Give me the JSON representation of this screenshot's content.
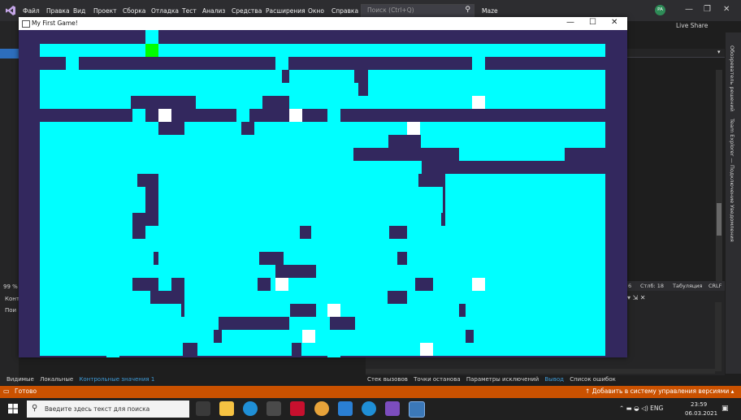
{
  "vs": {
    "menu": [
      "Файл",
      "Правка",
      "Вид",
      "Проект",
      "Сборка",
      "Отладка",
      "Тест",
      "Анализ",
      "Средства",
      "Расширения",
      "Окно",
      "Справка"
    ],
    "search_placeholder": "Поиск (Ctrl+Q)",
    "solution_name": "Maze",
    "avatar_initials": "PA",
    "live_share": "Live Share",
    "side_tabs": [
      "Обозреватель решений",
      "Team Explorer — Подключение",
      "Уведомления"
    ],
    "editor_status": {
      "col": "6",
      "line": "Стлб: 18",
      "indent": "Табуляция",
      "eol": "CRLF"
    },
    "left_zoom": "99 %",
    "left_panel_labels": [
      "Конт",
      "Пои"
    ],
    "bottom_tabs_left": [
      "Видимые",
      "Локальные",
      "Контрольные значения 1"
    ],
    "bottom_tabs_right": [
      "Стек вызовов",
      "Точки останова",
      "Параметры исключений",
      "Вывод",
      "Список ошибок"
    ],
    "active_right_tab": "Вывод",
    "status_ready": "Готово",
    "status_vcs": "Добавить в систему управления версиями",
    "accent_color": "#ca5100"
  },
  "taskbar": {
    "search_placeholder": "Введите здесь текст для поиска",
    "tray_lang": "ENG",
    "clock_time": "23:59",
    "clock_date": "06.03.2021"
  },
  "game": {
    "title": "My First Game!",
    "wall_color": "#33285e",
    "path_color": "#00ffff",
    "player_color": "#00ff00",
    "collectible_color": "#ffffff"
  }
}
